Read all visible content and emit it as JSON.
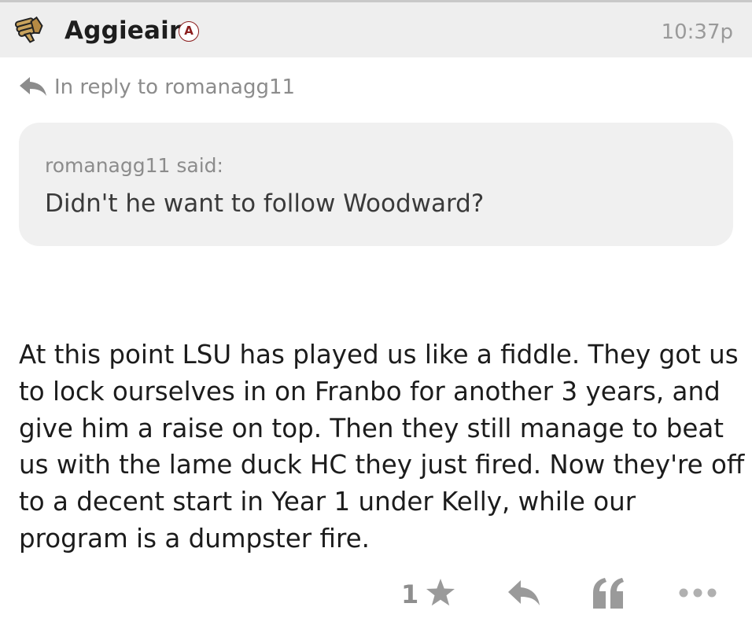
{
  "post": {
    "username": "Aggieair",
    "badge": "A",
    "timestamp": "10:37p",
    "reply_to": "In reply to romanagg11",
    "quote": {
      "author": "romanagg11 said:",
      "text": "Didn't he want to follow Woodward?"
    },
    "body_lines": [
      "At this point LSU has played us like a fiddle. They got us",
      "to lock ourselves in on Franbo for another 3 years, and",
      "give him a raise on top. Then they still manage to beat",
      "us with the lame duck HC they just fired. Now they're off",
      "to a decent start in Year 1 under Kelly, while our",
      "program is a dumpster fire."
    ]
  },
  "actions": {
    "like_count": "1",
    "icons": [
      "star-icon",
      "reply-icon",
      "quote-icon",
      "more-icon"
    ]
  },
  "colors": {
    "header_bg": "#eeeeee",
    "quote_bg": "#f0f0f0",
    "badge": "#8a1c1c",
    "muted_text": "#8c8c8c",
    "icon_gray": "#9a9a9a"
  }
}
